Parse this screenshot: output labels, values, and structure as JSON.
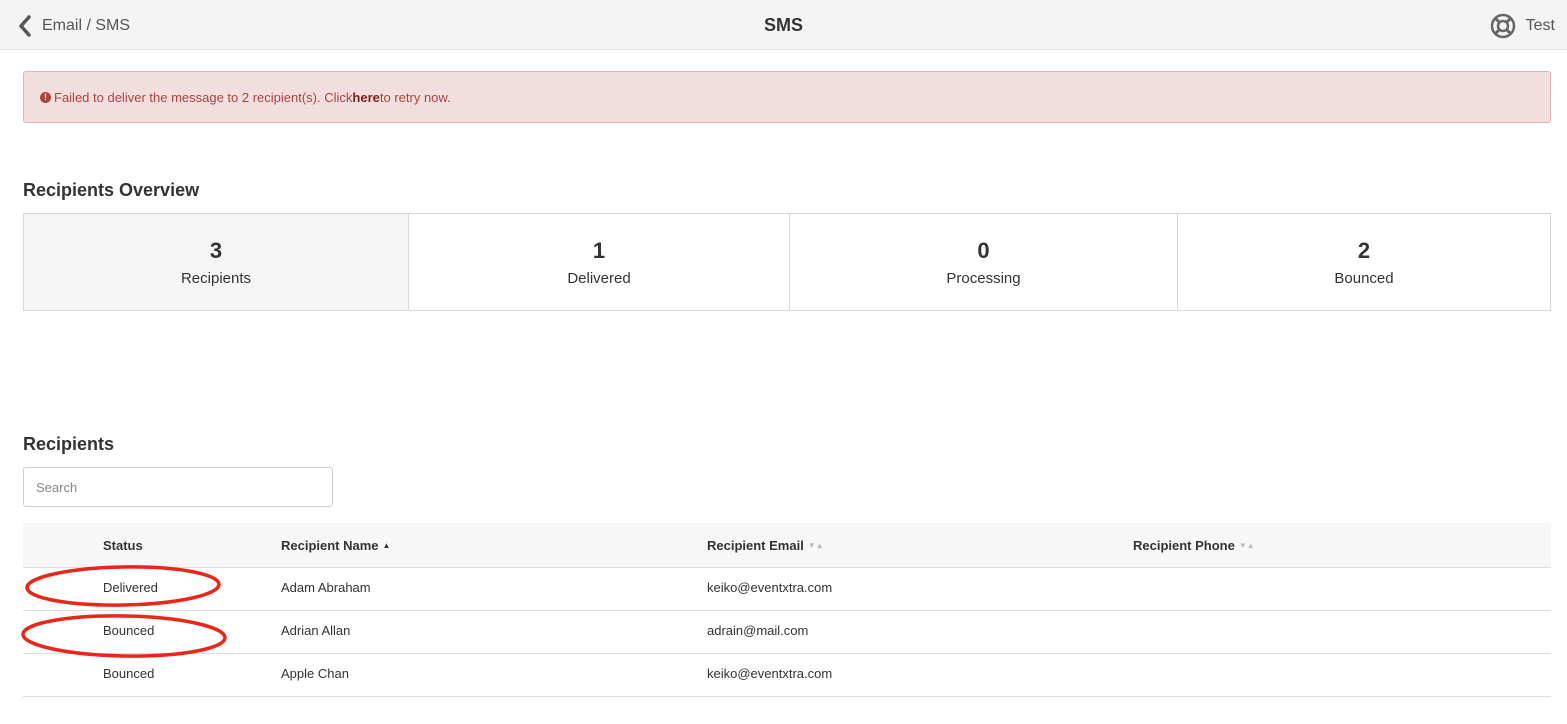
{
  "topbar": {
    "back_label": "Email / SMS",
    "title": "SMS",
    "help_label": "Test"
  },
  "alert": {
    "prefix": "Failed to deliver the message to 2 recipient(s). Click ",
    "link": "here",
    "suffix": " to retry now."
  },
  "overview": {
    "heading": "Recipients Overview",
    "stats": [
      {
        "value": "3",
        "label": "Recipients"
      },
      {
        "value": "1",
        "label": "Delivered"
      },
      {
        "value": "0",
        "label": "Processing"
      },
      {
        "value": "2",
        "label": "Bounced"
      }
    ]
  },
  "recipients": {
    "heading": "Recipients",
    "search_placeholder": "Search",
    "columns": [
      "Status",
      "Recipient Name",
      "Recipient Email",
      "Recipient Phone"
    ],
    "rows": [
      {
        "status": "Delivered",
        "name": "Adam  Abraham",
        "email": "keiko@eventxtra.com",
        "phone": ""
      },
      {
        "status": "Bounced",
        "name": "Adrian  Allan",
        "email": "adrain@mail.com",
        "phone": ""
      },
      {
        "status": "Bounced",
        "name": "Apple Chan",
        "email": "keiko@eventxtra.com",
        "phone": ""
      }
    ]
  },
  "colors": {
    "alert_bg": "#f2dede",
    "alert_text": "#a94442",
    "annotation": "#e8261a"
  }
}
